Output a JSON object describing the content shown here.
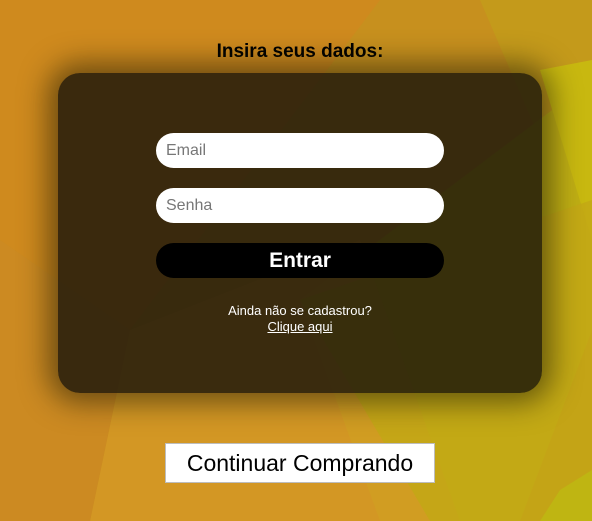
{
  "heading": "Insira seus dados:",
  "login": {
    "email_placeholder": "Email",
    "password_placeholder": "Senha",
    "submit_label": "Entrar",
    "signup_prompt": "Ainda não se cadastrou?",
    "signup_link": "Clique aqui"
  },
  "continue_label": "Continuar Comprando",
  "colors": {
    "background": "#c9921f",
    "card": "#1e180a",
    "button_dark": "#000000",
    "button_light": "#ffffff"
  }
}
